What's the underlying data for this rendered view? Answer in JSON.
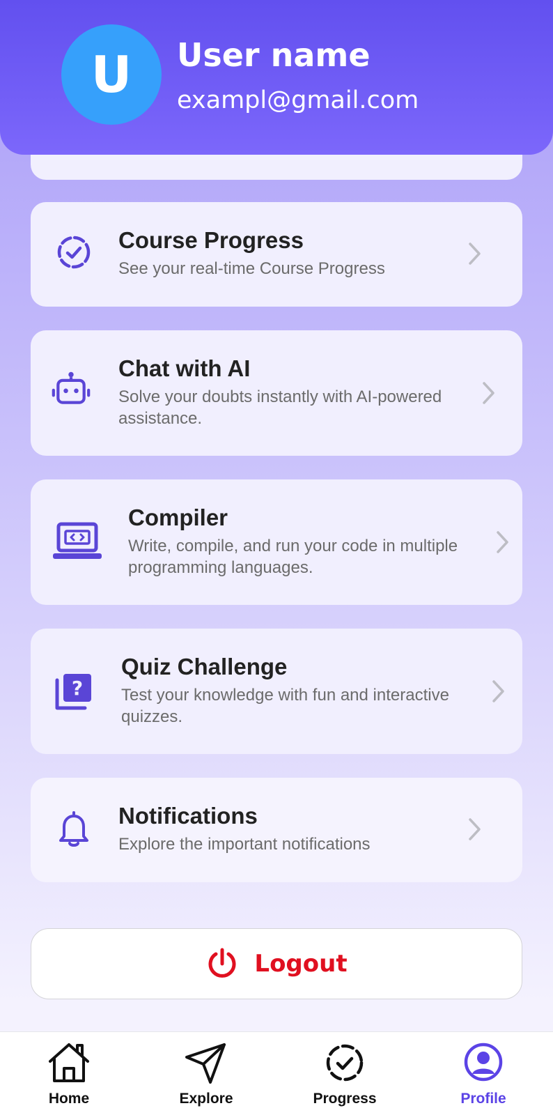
{
  "header": {
    "avatar_initial": "U",
    "user_name": "User name",
    "email": "exampl@gmail.com"
  },
  "menu": {
    "items": [
      {
        "title": "Course Progress",
        "description_lines": [
          "See your real-time Course Progress"
        ],
        "icon": "progress-check-icon"
      },
      {
        "title": "Chat with AI",
        "description_lines": [
          "Solve your doubts instantly with AI-powered",
          "assistance."
        ],
        "icon": "robot-icon"
      },
      {
        "title": "Compiler",
        "description_lines": [
          "Write, compile, and run your code in multiple",
          "programming languages."
        ],
        "icon": "laptop-code-icon"
      },
      {
        "title": "Quiz Challenge",
        "description_lines": [
          "Test your knowledge with fun and interactive",
          "quizzes."
        ],
        "icon": "quiz-icon"
      },
      {
        "title": "Notifications",
        "description_lines": [
          "Explore the important notifications"
        ],
        "icon": "bell-icon"
      }
    ]
  },
  "logout": {
    "label": "Logout",
    "color": "#e01020"
  },
  "tabbar": {
    "active": "Profile",
    "tabs": [
      {
        "label": "Home",
        "icon": "home-icon"
      },
      {
        "label": "Explore",
        "icon": "paper-plane-icon"
      },
      {
        "label": "Progress",
        "icon": "progress-check-icon"
      },
      {
        "label": "Profile",
        "icon": "profile-icon"
      }
    ]
  },
  "colors": {
    "header": "#6250ef",
    "avatar": "#36a0fb",
    "accent": "#5b43e6",
    "icon": "#5a45d6"
  }
}
